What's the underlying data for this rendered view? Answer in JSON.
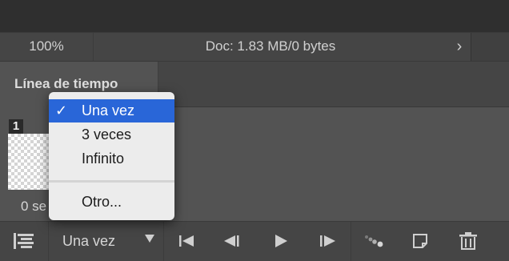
{
  "status_bar": {
    "zoom": "100%",
    "doc_info": "Doc: 1.83 MB/0 bytes",
    "expand_icon": "chevron-right-icon"
  },
  "panel": {
    "tab_title": "Línea de tiempo"
  },
  "frame": {
    "number": "1",
    "delay_visible": "0 se"
  },
  "loop_menu": {
    "selected_index": 0,
    "items": [
      {
        "label": "Una vez",
        "checked": true
      },
      {
        "label": "3 veces",
        "checked": false
      },
      {
        "label": "Infinito",
        "checked": false
      },
      {
        "label": "Otro...",
        "checked": false
      }
    ],
    "check_glyph": "✓"
  },
  "toolbar": {
    "loop_value": "Una vez",
    "icons": [
      "timeline-convert-icon",
      "dropdown-arrow-icon",
      "first-frame-icon",
      "previous-frame-icon",
      "play-icon",
      "next-frame-icon",
      "tween-icon",
      "duplicate-frame-icon",
      "trash-icon"
    ]
  },
  "colors": {
    "selection": "#2966d8",
    "menu_bg": "#ececec",
    "panel_bg": "#535353"
  }
}
